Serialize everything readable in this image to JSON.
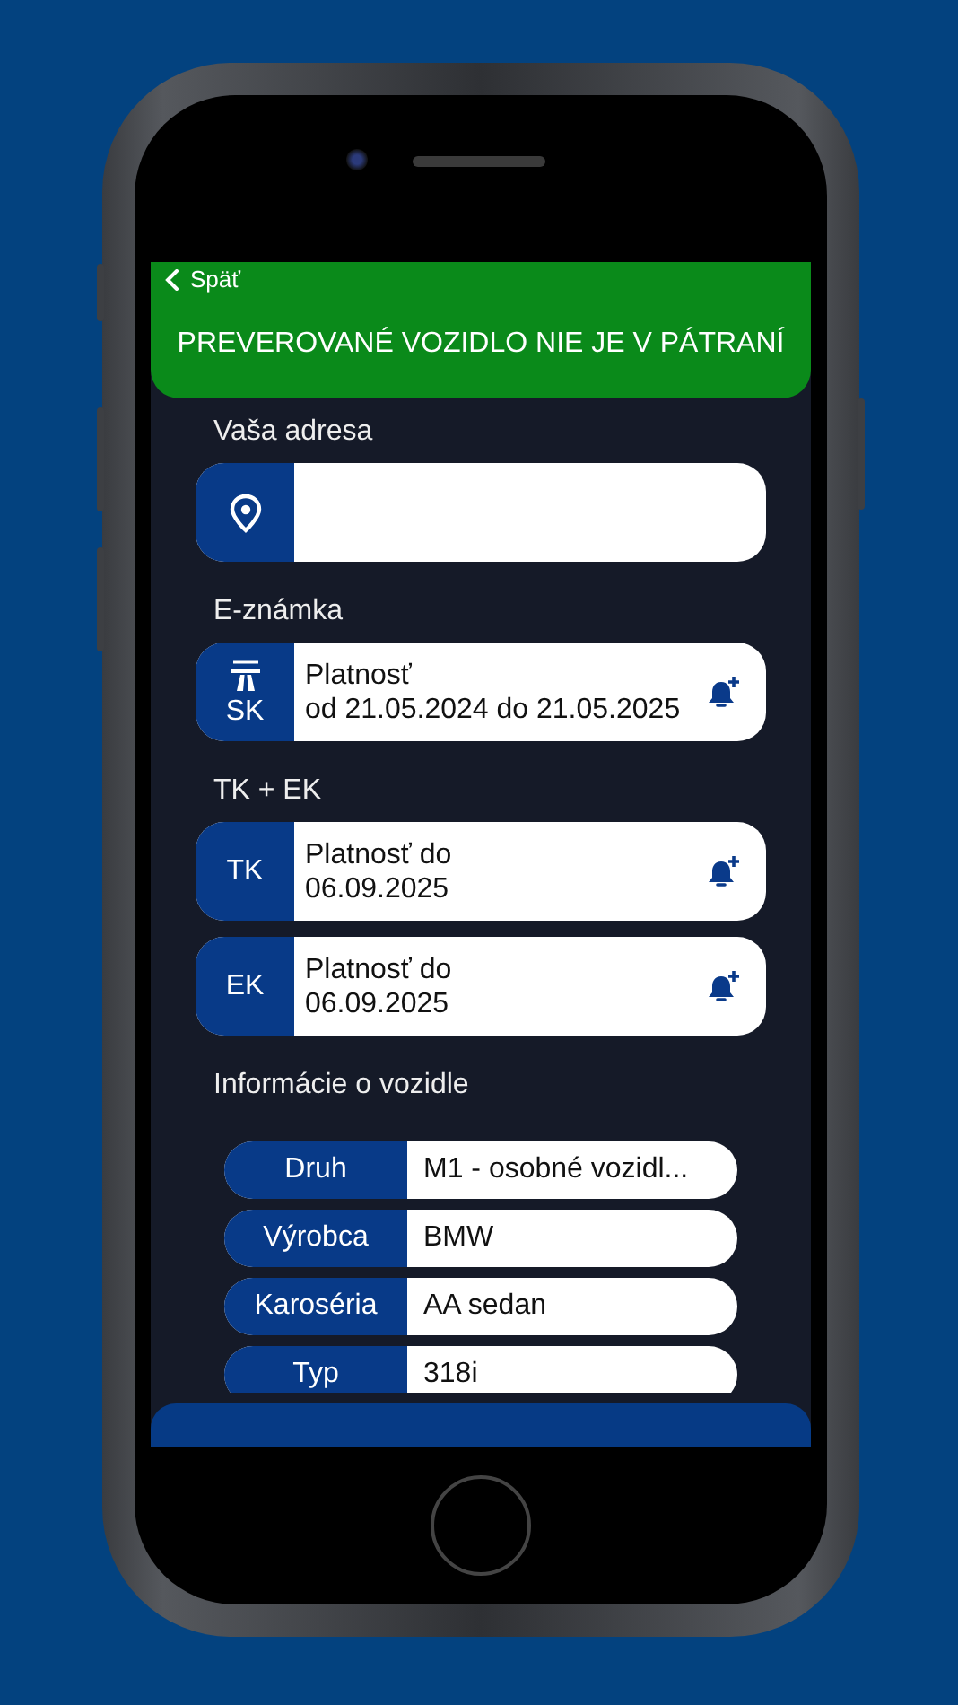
{
  "nav": {
    "back": "Späť"
  },
  "banner": {
    "text": "PREVEROVANÉ VOZIDLO NIE JE V PÁTRANÍ",
    "alert": false
  },
  "sections": [
    {
      "title": "Vaša adresa",
      "rows": [
        {
          "kind": "address"
        }
      ]
    },
    {
      "title": "E-známka",
      "rows": [
        {
          "kind": "highway",
          "badge": "SK",
          "lines": [
            "Platnosť",
            "od 21.05.2024 do 21.05.2025"
          ]
        }
      ]
    },
    {
      "title": "TK + EK",
      "rows": [
        {
          "kind": "code",
          "badge": "TK",
          "lines": [
            "Platnosť do",
            "06.09.2025"
          ]
        },
        {
          "kind": "code",
          "badge": "EK",
          "lines": [
            "Platnosť do",
            "06.09.2025"
          ]
        }
      ]
    }
  ],
  "vehicle": {
    "title": "Informácie o vozidle",
    "rows": [
      {
        "label": "Druh",
        "value": "M1 - osobné vozidl..."
      },
      {
        "label": "Výrobca",
        "value": "BMW"
      },
      {
        "label": "Karoséria",
        "value": "AA sedan"
      },
      {
        "label": "Typ",
        "value": "318i"
      }
    ]
  }
}
